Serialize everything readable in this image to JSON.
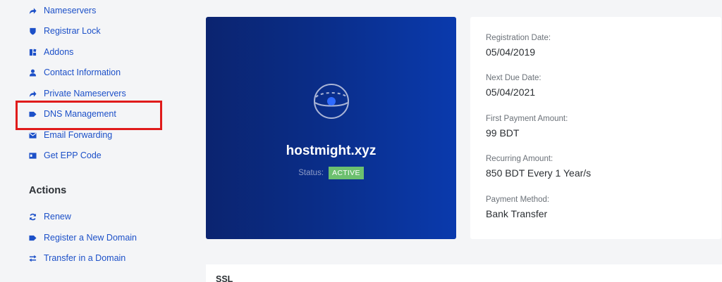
{
  "sidebar": {
    "items": [
      {
        "label": "Nameservers",
        "icon": "share-arrow-icon"
      },
      {
        "label": "Registrar Lock",
        "icon": "shield-icon"
      },
      {
        "label": "Addons",
        "icon": "cubes-icon"
      },
      {
        "label": "Contact Information",
        "icon": "user-icon"
      },
      {
        "label": "Private Nameservers",
        "icon": "share-arrow-icon"
      },
      {
        "label": "DNS Management",
        "icon": "tag-icon"
      },
      {
        "label": "Email Forwarding",
        "icon": "envelope-icon"
      },
      {
        "label": "Get EPP Code",
        "icon": "id-card-icon"
      }
    ],
    "actions_title": "Actions",
    "actions": [
      {
        "label": "Renew",
        "icon": "sync-icon"
      },
      {
        "label": "Register a New Domain",
        "icon": "tag-icon"
      },
      {
        "label": "Transfer in a Domain",
        "icon": "exchange-icon"
      }
    ],
    "link_color": "#1c50c8",
    "highlight_color": "#e01b1b"
  },
  "domain": {
    "name": "hostmight.xyz",
    "status_label": "Status:",
    "status": "ACTIVE",
    "status_color": "#6cc06f"
  },
  "info": {
    "registration_date_label": "Registration Date:",
    "registration_date": "05/04/2019",
    "next_due_label": "Next Due Date:",
    "next_due": "05/04/2021",
    "first_payment_label": "First Payment Amount:",
    "first_payment": "99 BDT",
    "recurring_label": "Recurring Amount:",
    "recurring": "850 BDT Every 1 Year/s",
    "payment_method_label": "Payment Method:",
    "payment_method": "Bank Transfer"
  },
  "ssl": {
    "title": "SSL"
  }
}
